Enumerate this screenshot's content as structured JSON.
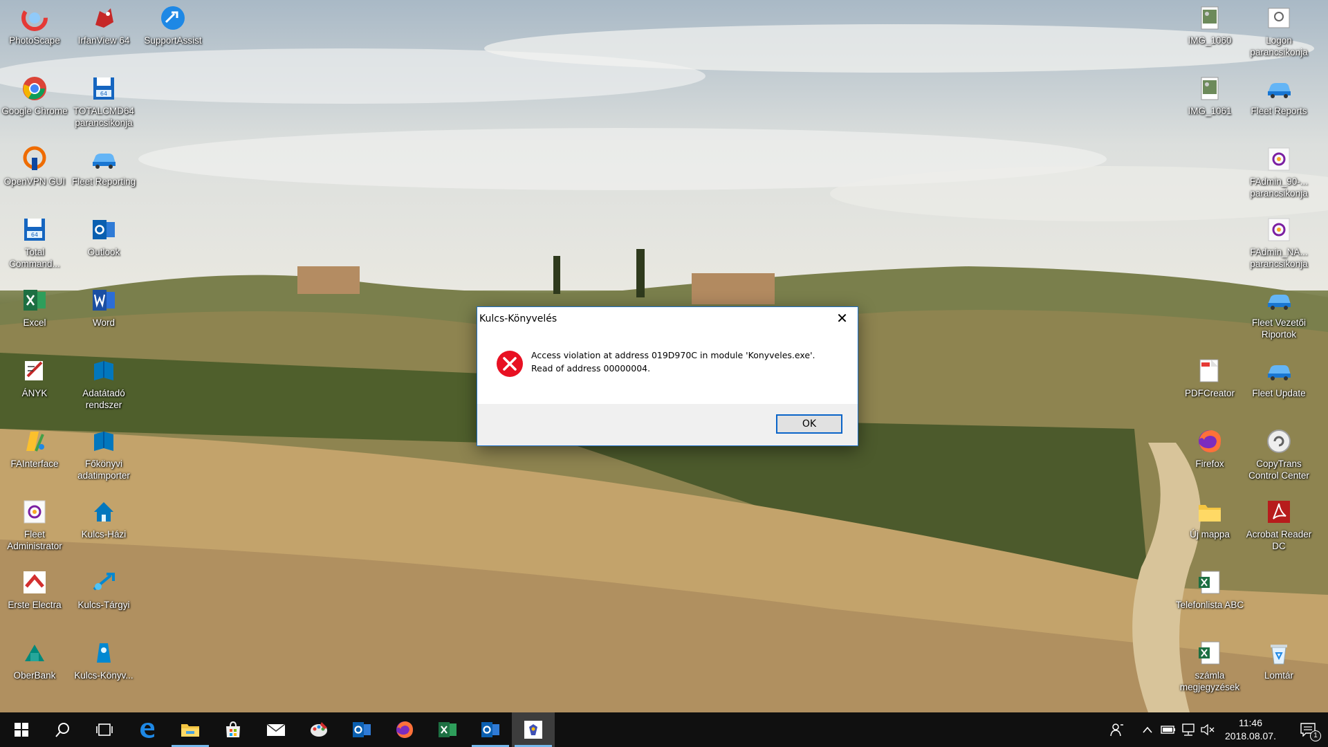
{
  "desktop": {
    "left_icons": [
      {
        "label": "PhotoScape",
        "icon": "photoscape-icon"
      },
      {
        "label": "IrfanView 64",
        "icon": "irfanview-icon"
      },
      {
        "label": "SupportAssist",
        "icon": "supportassist-icon"
      },
      {
        "label": "Google Chrome",
        "icon": "chrome-icon"
      },
      {
        "label": "TOTALCMD64 parancsikonja",
        "icon": "totalcmd-icon"
      },
      {
        "label": "OpenVPN GUI",
        "icon": "openvpn-icon"
      },
      {
        "label": "Fleet Reporting",
        "icon": "car-icon"
      },
      {
        "label": "Total Command...",
        "icon": "totalcmd-icon"
      },
      {
        "label": "Outlook",
        "icon": "outlook-icon"
      },
      {
        "label": "Excel",
        "icon": "excel-icon"
      },
      {
        "label": "Word",
        "icon": "word-icon"
      },
      {
        "label": "ÁNYK",
        "icon": "anyk-icon"
      },
      {
        "label": "Adatátadó rendszer",
        "icon": "book-icon"
      },
      {
        "label": "FAInterface",
        "icon": "fainterface-icon"
      },
      {
        "label": "Főkönyvi adatimporter",
        "icon": "book-icon"
      },
      {
        "label": "Fleet Administrator",
        "icon": "fleet-admin-icon"
      },
      {
        "label": "Kulcs-Házi",
        "icon": "kulcs-hazi-icon"
      },
      {
        "label": "Erste Electra",
        "icon": "erste-icon"
      },
      {
        "label": "Kulcs-Tárgyi",
        "icon": "kulcs-targyi-icon"
      },
      {
        "label": "OberBank",
        "icon": "oberbank-icon"
      },
      {
        "label": "Kulcs-Könyv...",
        "icon": "kulcs-konyv-icon"
      }
    ],
    "right_icons": [
      {
        "label": "IMG_1060",
        "icon": "image-file-icon"
      },
      {
        "label": "Logon parancsikonja",
        "icon": "logon-icon"
      },
      {
        "label": "IMG_1061",
        "icon": "image-file-icon"
      },
      {
        "label": "Fleet Reports",
        "icon": "car-icon"
      },
      {
        "label": "FAdmin_90-... parancsikonja",
        "icon": "fleet-admin-icon"
      },
      {
        "label": "FAdmin_NA... parancsikonja",
        "icon": "fleet-admin-icon"
      },
      {
        "label": "Fleet Vezetői Riportok",
        "icon": "car-icon"
      },
      {
        "label": "PDFCreator",
        "icon": "pdfcreator-icon"
      },
      {
        "label": "Fleet Update",
        "icon": "car-icon"
      },
      {
        "label": "Firefox",
        "icon": "firefox-icon"
      },
      {
        "label": "CopyTrans Control Center",
        "icon": "copytrans-icon"
      },
      {
        "label": "Új mappa",
        "icon": "folder-icon"
      },
      {
        "label": "Acrobat Reader DC",
        "icon": "acrobat-icon"
      },
      {
        "label": "Telefonlista ABC",
        "icon": "excel-file-icon"
      },
      {
        "label": "számla megjegyzések",
        "icon": "excel-file-icon"
      },
      {
        "label": "Lomtár",
        "icon": "recycle-bin-icon"
      }
    ]
  },
  "dialog": {
    "title": "Kulcs-Könyvelés",
    "close_label": "✕",
    "message": "Access violation at address 019D970C in module 'Konyveles.exe'. Read of address 00000004.",
    "ok_label": "OK",
    "icon": "error-icon",
    "accent": "#e81123"
  },
  "taskbar": {
    "apps": [
      {
        "name": "start-button",
        "icon": "windows-logo-icon"
      },
      {
        "name": "search-button",
        "icon": "search-icon"
      },
      {
        "name": "task-view-button",
        "icon": "task-view-icon"
      },
      {
        "name": "taskbar-edge",
        "icon": "edge-icon"
      },
      {
        "name": "taskbar-explorer",
        "icon": "folder-icon"
      },
      {
        "name": "taskbar-store",
        "icon": "store-icon"
      },
      {
        "name": "taskbar-mail",
        "icon": "mail-icon"
      },
      {
        "name": "taskbar-paint",
        "icon": "paint-icon"
      },
      {
        "name": "taskbar-outlook",
        "icon": "outlook-icon"
      },
      {
        "name": "taskbar-firefox",
        "icon": "firefox-icon"
      },
      {
        "name": "taskbar-excel",
        "icon": "excel-icon"
      },
      {
        "name": "taskbar-outlook-2",
        "icon": "outlook-icon"
      },
      {
        "name": "taskbar-kulcs",
        "icon": "kulcs-icon"
      }
    ],
    "clock_time": "11:46",
    "clock_date": "2018.08.07.",
    "notification_count": "1",
    "accent": "#76b9ed"
  }
}
